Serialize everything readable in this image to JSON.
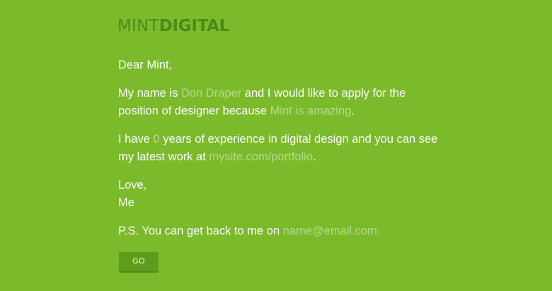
{
  "logo": {
    "part1": "MINT",
    "part2": "DIGITAL"
  },
  "letter": {
    "greeting": "Dear Mint,",
    "intro": {
      "prefix": "My name is ",
      "name_placeholder": "Don Draper",
      "middle": " and I would like to apply for the position of designer because ",
      "reason_placeholder": "Mint is amazing",
      "suffix": "."
    },
    "experience": {
      "prefix": "I have ",
      "years_placeholder": "0",
      "middle": " years of experience in digital design and you can see my latest work at ",
      "portfolio_placeholder": "mysite.com/portfolio",
      "suffix": "."
    },
    "closing": {
      "line1": "Love,",
      "line2": "Me"
    },
    "ps": {
      "prefix": "P.S. You can get back to me on ",
      "email_placeholder": "name@email.com"
    }
  },
  "submit": {
    "label": "GO"
  },
  "colors": {
    "background": "#7bba2a",
    "logo": "#4c8a18",
    "placeholder": "#b6d98c",
    "button": "#5e9c1b",
    "text": "#ffffff"
  }
}
